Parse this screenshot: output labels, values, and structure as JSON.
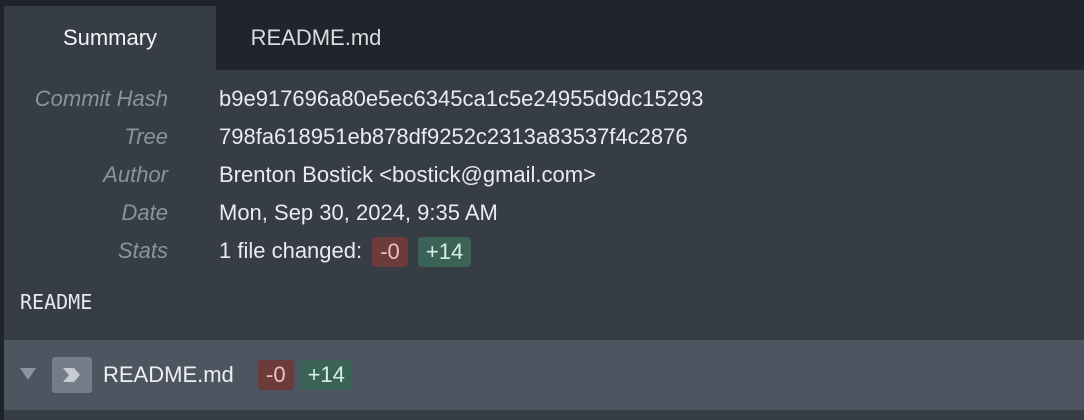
{
  "tabs": [
    {
      "label": "Summary",
      "active": true
    },
    {
      "label": "README.md",
      "active": false
    }
  ],
  "summary": {
    "commit_hash": {
      "label": "Commit Hash",
      "value": "b9e917696a80e5ec6345ca1c5e24955d9dc15293"
    },
    "tree": {
      "label": "Tree",
      "value": "798fa618951eb878df9252c2313a83537f4c2876"
    },
    "author": {
      "label": "Author",
      "value": "Brenton Bostick <bostick@gmail.com>"
    },
    "date": {
      "label": "Date",
      "value": "Mon, Sep 30, 2024, 9:35 AM"
    },
    "stats": {
      "label": "Stats",
      "text": "1 file changed:",
      "deletions": "-0",
      "additions": "+14"
    }
  },
  "readme_section": {
    "heading": "README"
  },
  "files": [
    {
      "name": "README.md",
      "deletions": "-0",
      "additions": "+14",
      "expanded": false,
      "icon": "markdown-file-icon"
    }
  ],
  "colors": {
    "background": "#373d45",
    "tabbar": "#20252b",
    "file_row": "#4c5560",
    "deletions_badge": "#6d3b3a",
    "additions_badge": "#3b6257",
    "label_text": "#8c939d"
  }
}
